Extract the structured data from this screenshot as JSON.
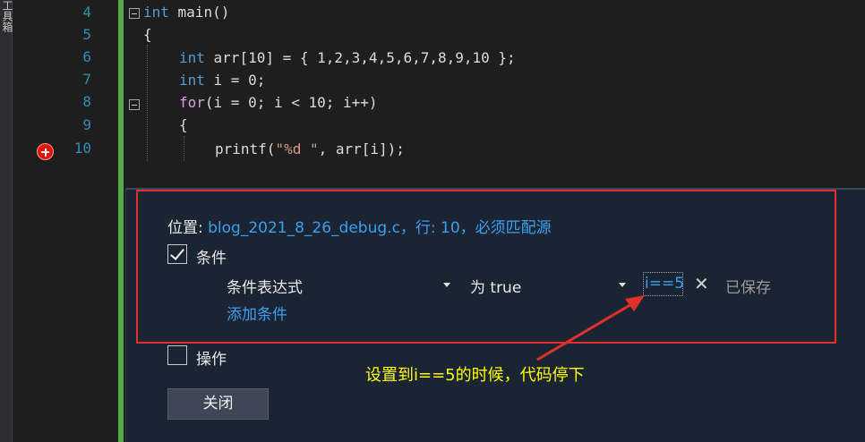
{
  "tool_strip": {
    "label": "工具箱"
  },
  "line_numbers": [
    "4",
    "5",
    "6",
    "7",
    "8",
    "9",
    "10"
  ],
  "code": {
    "line4": {
      "kw": "int",
      "rest": " main()"
    },
    "line5": "{",
    "line6": {
      "kw": "int",
      "rest": " arr[10] = { 1,2,3,4,5,6,7,8,9,10 };"
    },
    "line7": {
      "kw": "int",
      "rest": " i = 0;"
    },
    "line8": {
      "kw": "for",
      "rest": "(i = 0; i < 10; i++)"
    },
    "line9": "{",
    "line10": {
      "fn": "printf(",
      "str": "\"%d \"",
      "rest": ", arr[i]);"
    }
  },
  "breakpoint_settings": {
    "location_label": "位置: ",
    "location_value": "blog_2021_8_26_debug.c，行: 10，必须匹配源",
    "conditions_label": "条件",
    "conditions_checked": true,
    "condition_type": "条件表达式",
    "condition_when": "为 true",
    "condition_expression": "i==5",
    "saved_text": "已保存",
    "add_condition": "添加条件",
    "actions_label": "操作",
    "actions_checked": false,
    "close_button": "关闭"
  },
  "annotation": "设置到i==5的时候，代码停下",
  "colors": {
    "highlight_border": "#e0322b",
    "annotation_text": "#ffff00",
    "link": "#3aa0f3",
    "breakpoint": "#e51400"
  }
}
